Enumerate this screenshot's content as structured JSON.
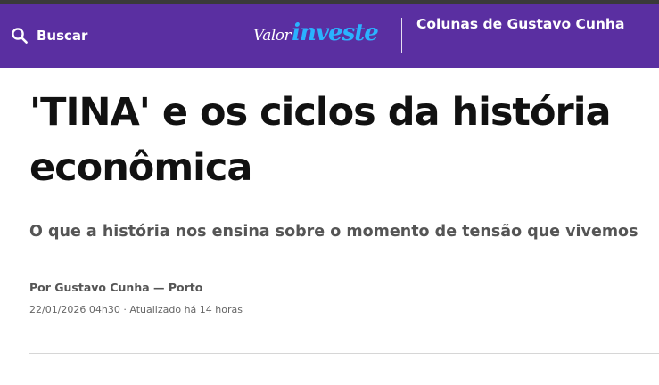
{
  "header": {
    "search_label": "Buscar",
    "search_icon": "search-icon",
    "logo_part1": "Valor",
    "logo_part2": "investe",
    "column_title": "Colunas de Gustavo Cunha",
    "background_color": "#5a2fa1",
    "logo_accent_color": "#2ab3ff"
  },
  "article": {
    "title": "'TINA' e os ciclos da história econômica",
    "subtitle": "O que a história nos ensina sobre o momento de tensão que vivemos",
    "byline": "Por Gustavo Cunha — Porto",
    "date_published": "22/01/2026 04h30",
    "date_separator": "·",
    "date_updated": "Atualizado há 14 horas"
  }
}
